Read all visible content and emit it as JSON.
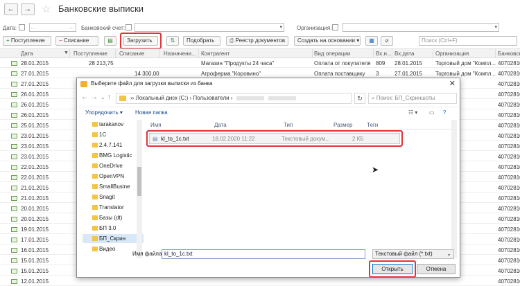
{
  "header": {
    "back_icon": "←",
    "forward_icon": "→",
    "star_icon": "☆",
    "title": "Банковские выписки"
  },
  "filters": {
    "date_label": "Дата:",
    "date_placeholder": ". .",
    "account_label": "Банковский счет:",
    "org_label": "Организация:"
  },
  "toolbar": {
    "income": "Поступление",
    "expense": "Списание",
    "load": "Загрузить",
    "select": "Подобрать",
    "registry": "Реестр документов",
    "create_based": "Создать на основании",
    "search_placeholder": "Поиск (Ctrl+F)"
  },
  "table": {
    "columns": [
      "Дата",
      "Поступление",
      "Списание",
      "Назначени...",
      "Контрагент",
      "Вид операции",
      "Вх.н...",
      "Вх.дата",
      "Организация",
      "Банковск"
    ],
    "rows": [
      {
        "date": "28.01.2015",
        "income": "28 213,75",
        "expense": "",
        "counterparty": "Магазин \"Продукты 24 часа\"",
        "op": "Оплата от покупателя",
        "num": "809",
        "indate": "28.01.2015",
        "org": "Торговый дом \"Компл...",
        "bank": "407028101"
      },
      {
        "date": "27.01.2015",
        "income": "",
        "expense": "14 300,00",
        "counterparty": "Агроферма \"Коровино\"",
        "op": "Оплата поставщику",
        "num": "3",
        "indate": "27.01.2015",
        "org": "Торговый дом \"Компл...",
        "bank": "407028101"
      },
      {
        "date": "27.01.2015",
        "income": "",
        "expense": "",
        "counterparty": "",
        "op": "",
        "num": "",
        "indate": "",
        "org": "",
        "bank": "407028101"
      },
      {
        "date": "26.01.2015",
        "income": "",
        "expense": "",
        "counterparty": "",
        "op": "",
        "num": "",
        "indate": "",
        "org": "",
        "bank": "407028101"
      },
      {
        "date": "26.01.2015",
        "income": "",
        "expense": "",
        "counterparty": "",
        "op": "",
        "num": "",
        "indate": "",
        "org": "",
        "bank": "407028101"
      },
      {
        "date": "26.01.2015",
        "income": "",
        "expense": "",
        "counterparty": "",
        "op": "",
        "num": "",
        "indate": "",
        "org": "",
        "bank": "407028101"
      },
      {
        "date": "25.01.2015",
        "income": "",
        "expense": "",
        "counterparty": "",
        "op": "",
        "num": "",
        "indate": "",
        "org": "",
        "bank": "407028101"
      },
      {
        "date": "23.01.2015",
        "income": "",
        "expense": "",
        "counterparty": "",
        "op": "",
        "num": "",
        "indate": "",
        "org": "",
        "bank": "407028101"
      },
      {
        "date": "23.01.2015",
        "income": "",
        "expense": "",
        "counterparty": "",
        "op": "",
        "num": "",
        "indate": "",
        "org": "",
        "bank": "407028101"
      },
      {
        "date": "23.01.2015",
        "income": "",
        "expense": "",
        "counterparty": "",
        "op": "",
        "num": "",
        "indate": "",
        "org": "",
        "bank": "407028101"
      },
      {
        "date": "22.01.2015",
        "income": "",
        "expense": "",
        "counterparty": "",
        "op": "",
        "num": "",
        "indate": "",
        "org": "",
        "bank": "407028101"
      },
      {
        "date": "22.01.2015",
        "income": "",
        "expense": "",
        "counterparty": "",
        "op": "",
        "num": "",
        "indate": "",
        "org": "",
        "bank": "407028101"
      },
      {
        "date": "21.01.2015",
        "income": "",
        "expense": "",
        "counterparty": "",
        "op": "",
        "num": "",
        "indate": "",
        "org": "",
        "bank": "407028101"
      },
      {
        "date": "21.01.2015",
        "income": "",
        "expense": "",
        "counterparty": "",
        "op": "",
        "num": "",
        "indate": "",
        "org": "",
        "bank": "407028101"
      },
      {
        "date": "20.01.2015",
        "income": "",
        "expense": "",
        "counterparty": "",
        "op": "",
        "num": "",
        "indate": "",
        "org": "",
        "bank": "407028101"
      },
      {
        "date": "20.01.2015",
        "income": "",
        "expense": "",
        "counterparty": "",
        "op": "",
        "num": "",
        "indate": "",
        "org": "",
        "bank": "407028101"
      },
      {
        "date": "19.01.2015",
        "income": "",
        "expense": "",
        "counterparty": "",
        "op": "",
        "num": "",
        "indate": "",
        "org": "",
        "bank": "407028101"
      },
      {
        "date": "17.01.2015",
        "income": "",
        "expense": "",
        "counterparty": "",
        "op": "",
        "num": "",
        "indate": "",
        "org": "",
        "bank": "407028101"
      },
      {
        "date": "16.01.2015",
        "income": "",
        "expense": "",
        "counterparty": "",
        "op": "",
        "num": "",
        "indate": "",
        "org": "",
        "bank": "407028101"
      },
      {
        "date": "15.01.2015",
        "income": "",
        "expense": "",
        "counterparty": "",
        "op": "",
        "num": "",
        "indate": "",
        "org": "",
        "bank": "407028101"
      },
      {
        "date": "15.01.2015",
        "income": "",
        "expense": "",
        "counterparty": "",
        "op": "",
        "num": "",
        "indate": "",
        "org": "",
        "bank": "407028101"
      },
      {
        "date": "12.01.2015",
        "income": "",
        "expense": "",
        "counterparty": "",
        "op": "",
        "num": "",
        "indate": "",
        "org": "",
        "bank": "407028101"
      }
    ]
  },
  "dialog": {
    "title": "Выберите файл для загрузки выписки из банка",
    "close_icon": "✕",
    "path_computer": "Локальный диск (C:)",
    "path_users": "Пользователи",
    "search_placeholder": "Поиск: БП_Скриншоты",
    "organize": "Упорядочить ▾",
    "new_folder": "Новая папка",
    "tree": [
      "tarakanov",
      "1C",
      "2.4.7.141",
      "BMG Logistic",
      "OneDrive",
      "OpenVPN",
      "SmallBusine",
      "Snagit",
      "Translator",
      "Базы (dt)",
      "БП 3.0",
      "БП_Скрин",
      "Видео"
    ],
    "file_columns": [
      "Имя",
      "Дата",
      "Тип",
      "Размер",
      "Теги"
    ],
    "file": {
      "name": "kl_to_1c.txt",
      "date": "18.02.2020 11:22",
      "type": "Текстовый докум...",
      "size": "2 КБ"
    },
    "filename_label": "Имя файла:",
    "filename_value": "kl_to_1c.txt",
    "filetype": "Текстовый файл (*.txt)",
    "open": "Открыть",
    "cancel": "Отмена"
  },
  "colors": {
    "highlight": "#e0343a",
    "accent": "#0078d7",
    "folder": "#f4c542"
  }
}
